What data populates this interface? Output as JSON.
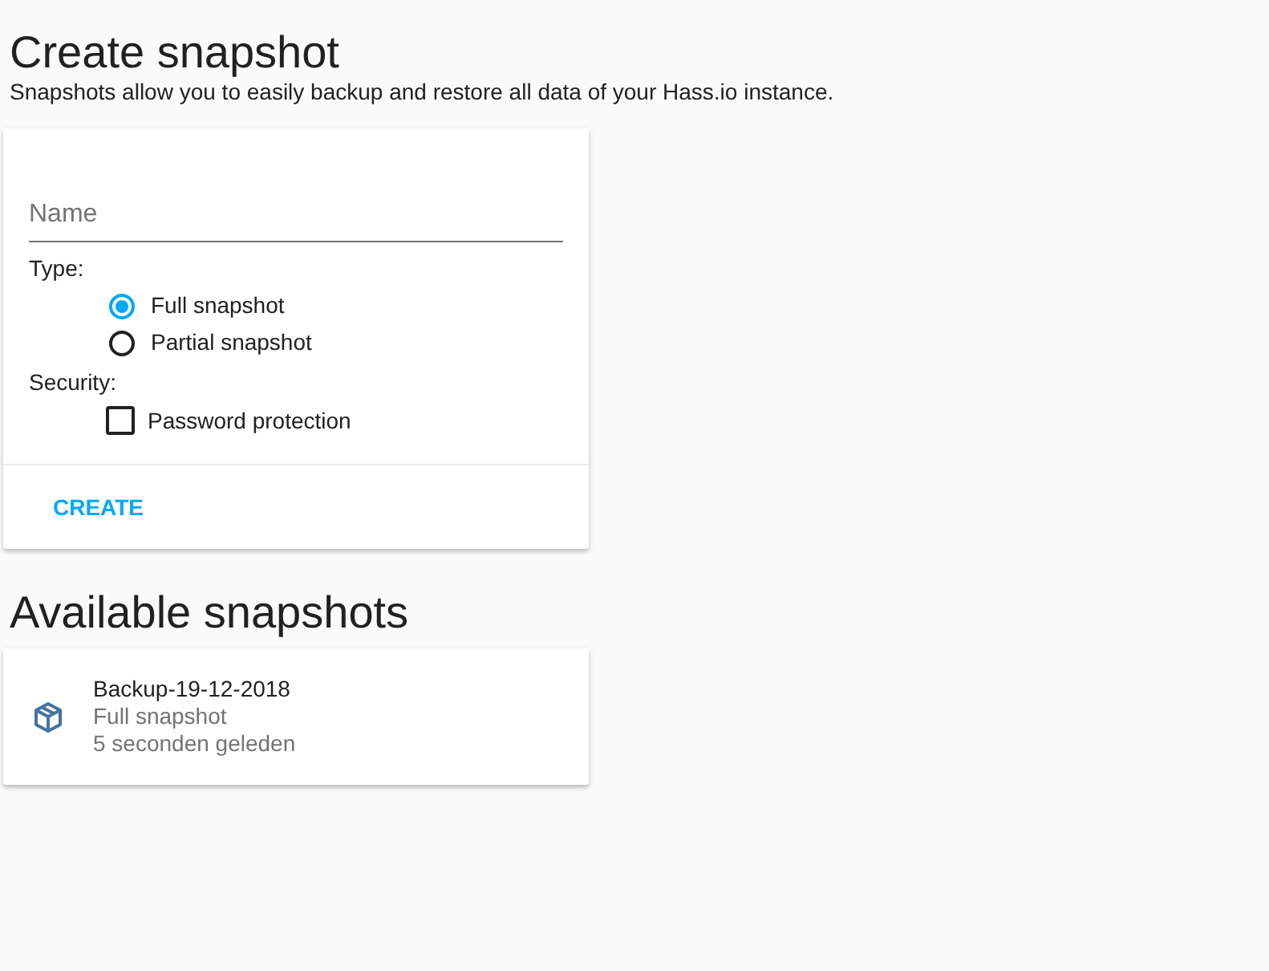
{
  "create_section": {
    "title": "Create snapshot",
    "description": "Snapshots allow you to easily backup and restore all data of your Hass.io instance."
  },
  "create_form": {
    "name_field": {
      "placeholder": "Name"
    },
    "type_label": "Type:",
    "type_options": [
      {
        "label": "Full snapshot",
        "selected": true
      },
      {
        "label": "Partial snapshot",
        "selected": false
      }
    ],
    "security_label": "Security:",
    "security_options": [
      {
        "label": "Password protection",
        "checked": false
      }
    ],
    "create_button": "CREATE"
  },
  "available_section": {
    "title": "Available snapshots",
    "snapshots": [
      {
        "name": "Backup-19-12-2018",
        "type": "Full snapshot",
        "time": "5 seconden geleden"
      }
    ]
  }
}
